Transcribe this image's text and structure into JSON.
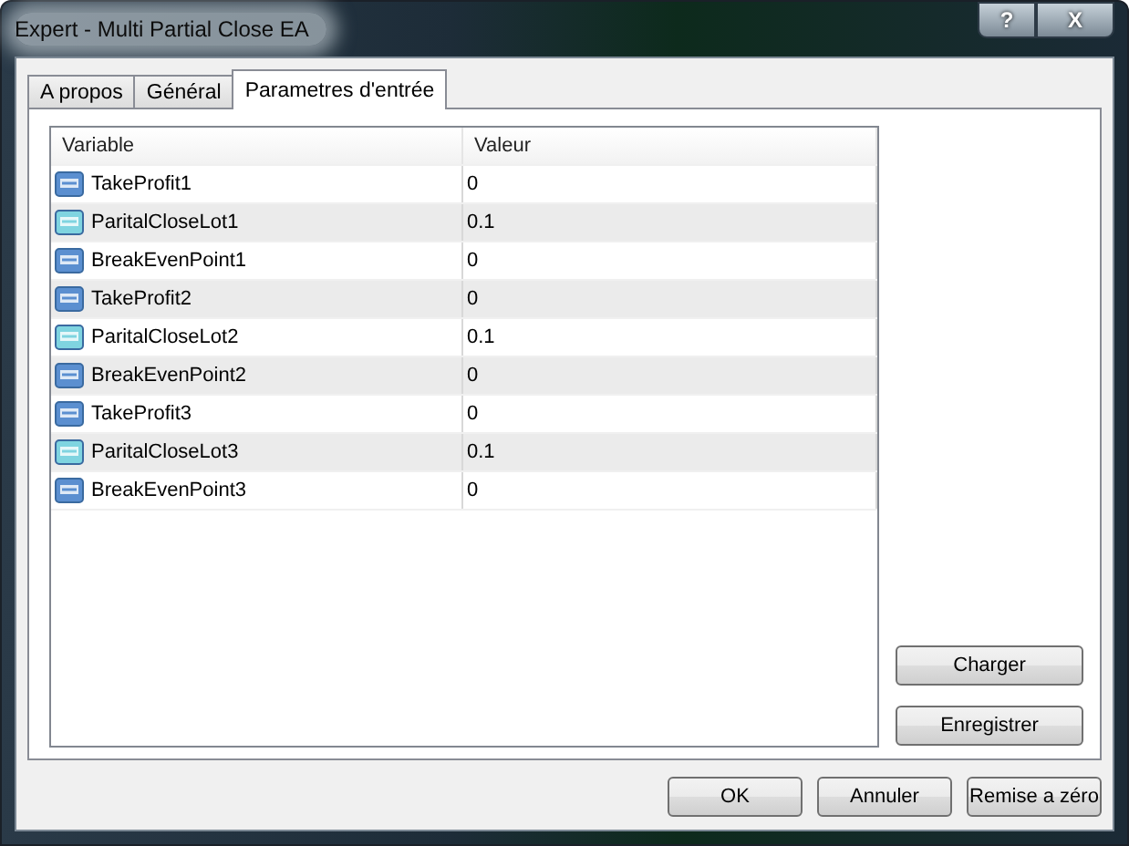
{
  "window": {
    "title": "Expert - Multi Partial Close EA",
    "controls": [
      {
        "kind": "help",
        "label": "?"
      },
      {
        "kind": "close",
        "label": "X"
      }
    ]
  },
  "tabs": [
    {
      "label": "A propos",
      "selected": false
    },
    {
      "label": "Général",
      "selected": false
    },
    {
      "label": "Parametres d'entrée",
      "selected": true
    }
  ],
  "table": {
    "columns": [
      "Variable",
      "Valeur"
    ],
    "rows": [
      {
        "kind": "int",
        "variable": "TakeProfit1",
        "value": "0"
      },
      {
        "kind": "double",
        "variable": "ParitalCloseLot1",
        "value": "0.1"
      },
      {
        "kind": "int",
        "variable": "BreakEvenPoint1",
        "value": "0"
      },
      {
        "kind": "int",
        "variable": "TakeProfit2",
        "value": "0"
      },
      {
        "kind": "double",
        "variable": "ParitalCloseLot2",
        "value": "0.1"
      },
      {
        "kind": "int",
        "variable": "BreakEvenPoint2",
        "value": "0"
      },
      {
        "kind": "int",
        "variable": "TakeProfit3",
        "value": "0"
      },
      {
        "kind": "double",
        "variable": "ParitalCloseLot3",
        "value": "0.1"
      },
      {
        "kind": "int",
        "variable": "BreakEvenPoint3",
        "value": "0"
      }
    ]
  },
  "side_buttons": [
    "Charger",
    "Enregistrer"
  ],
  "buttons": [
    "OK",
    "Annuler",
    "Remise a zéro"
  ]
}
